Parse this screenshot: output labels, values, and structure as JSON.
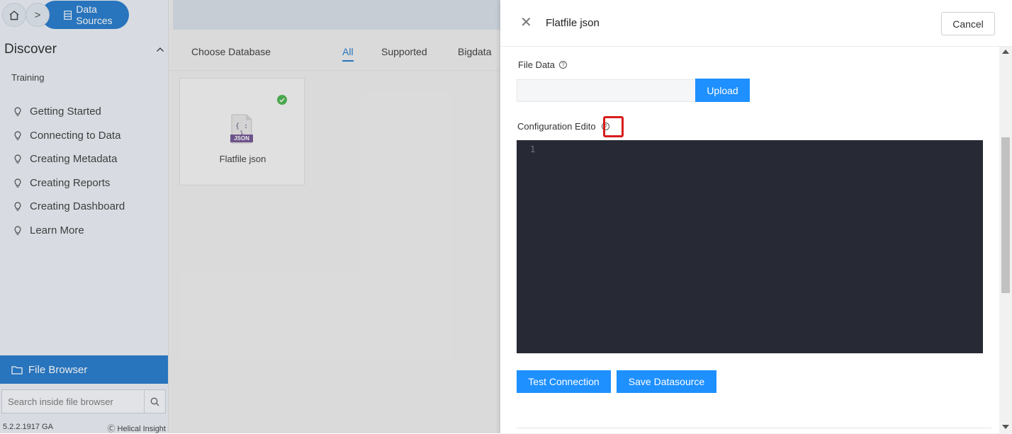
{
  "breadcrumb": {
    "home_icon": "home-icon",
    "arrow": ">",
    "data_sources": "Data Sources"
  },
  "sidebar": {
    "discover": "Discover",
    "training": "Training",
    "items": [
      {
        "label": "Getting Started",
        "icon": "bulb-icon"
      },
      {
        "label": "Connecting to Data",
        "icon": "bulb-icon"
      },
      {
        "label": "Creating Metadata",
        "icon": "bulb-icon"
      },
      {
        "label": "Creating Reports",
        "icon": "bulb-icon"
      },
      {
        "label": "Creating Dashboard",
        "icon": "bulb-icon"
      },
      {
        "label": "Learn More",
        "icon": "bulb-icon"
      }
    ],
    "file_browser": "File Browser",
    "search_placeholder": "Search inside file browser",
    "version": "5.2.2.1917 GA",
    "copyright": "Ⓒ Helical Insight"
  },
  "main": {
    "choose_database": "Choose Database",
    "tabs": [
      "All",
      "Supported",
      "Bigdata"
    ],
    "card_label": "Flatfile json",
    "json_badge": "JSON",
    "json_glyph": "{ : }"
  },
  "panel": {
    "title": "Flatfile json",
    "cancel": "Cancel",
    "file_data_label": "File Data",
    "upload": "Upload",
    "config_label": "Configuration Edito",
    "line_number": "1",
    "test_connection": "Test Connection",
    "save_datasource": "Save Datasource"
  },
  "colors": {
    "primary": "#1e90ff",
    "sidebar_bar": "#1b74c9",
    "editor_bg": "#272a35",
    "highlight": "#d81c1c",
    "check": "#43b047"
  }
}
